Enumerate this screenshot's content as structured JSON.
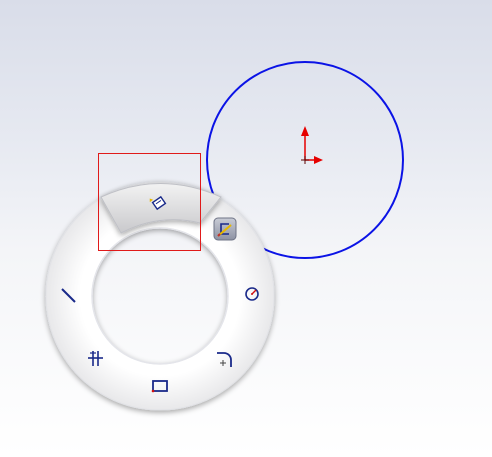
{
  "graphics_area": {
    "sketch_entity": "circle",
    "origin_marker": "origin-icon",
    "colors": {
      "background_top": "#d9dde9",
      "background_bottom": "#ffffff",
      "circle_stroke": "#0b13e6",
      "origin": "#e60000",
      "selection_box": "#e01a1a",
      "tool_icon": "#1a2a8a"
    }
  },
  "mouse_gesture_wheel": {
    "highlighted_slot": "top",
    "tools": [
      {
        "slot": "top",
        "icon": "smart-dimension-icon"
      },
      {
        "slot": "left",
        "icon": "line-icon"
      },
      {
        "slot": "right",
        "icon": "circle-tool-icon"
      },
      {
        "slot": "bottom-left",
        "icon": "trim-entities-icon"
      },
      {
        "slot": "bottom",
        "icon": "rectangle-icon"
      },
      {
        "slot": "bottom-right",
        "icon": "tangent-arc-icon"
      }
    ],
    "side_button": {
      "icon": "exit-sketch-icon"
    }
  }
}
